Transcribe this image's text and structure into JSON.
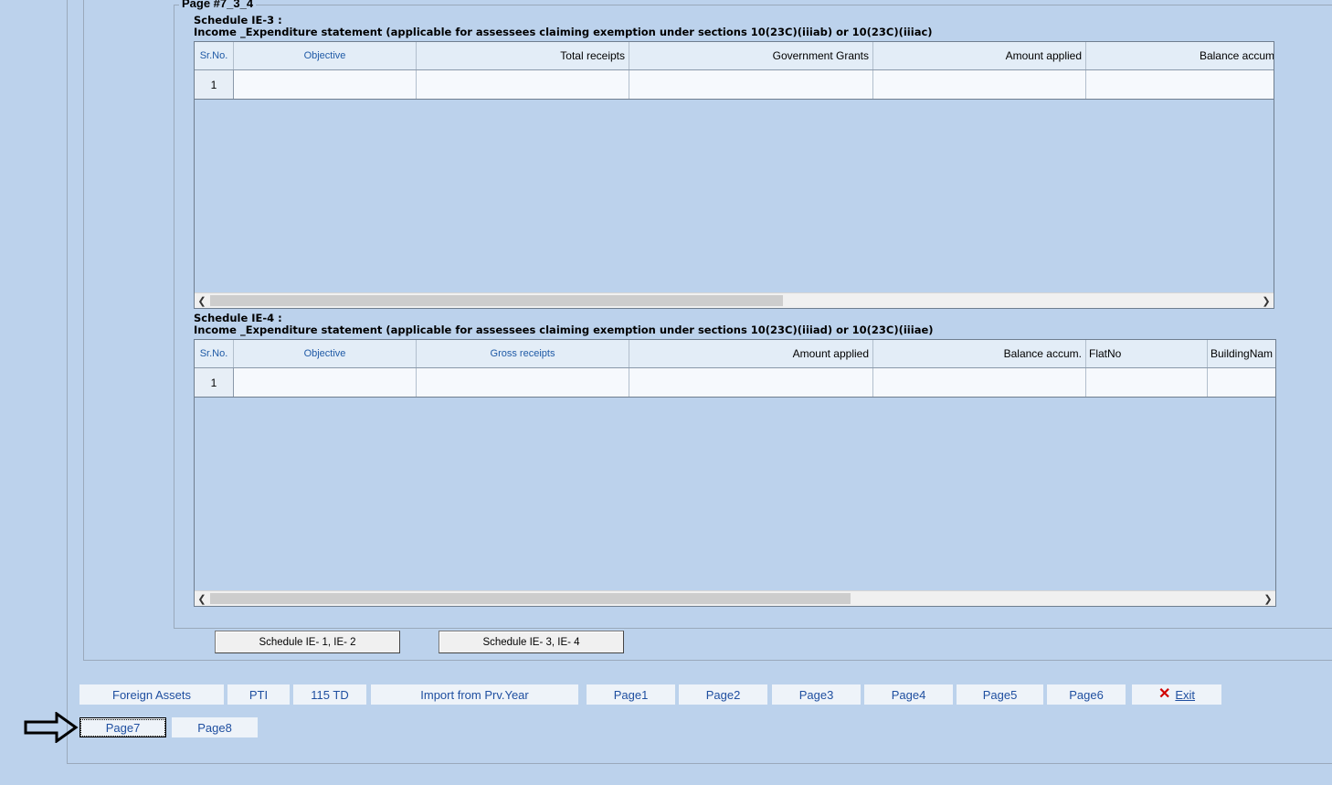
{
  "page": {
    "legend": "Page #7_3_4"
  },
  "ie3": {
    "title_line1": "Schedule IE-3 :",
    "title_line2": "Income _Expenditure statement (applicable for assessees claiming exemption under sections 10(23C)(iiiab) or 10(23C)(iiiac)",
    "columns": [
      "Sr.No.",
      "Objective",
      "Total receipts",
      "Government Grants",
      "Amount applied",
      "Balance accum"
    ],
    "rows": [
      {
        "sr": "1",
        "cells": [
          "",
          "",
          "",
          "",
          ""
        ]
      }
    ]
  },
  "ie4": {
    "title_line1": "Schedule IE-4 :",
    "title_line2": "Income _Expenditure statement (applicable for assessees claiming exemption under sections 10(23C)(iiiad) or 10(23C)(iiiae)",
    "columns": [
      "Sr.No.",
      "Objective",
      "Gross receipts",
      "Amount applied",
      "Balance accum.",
      "FlatNo",
      "BuildingNam"
    ],
    "rows": [
      {
        "sr": "1",
        "cells": [
          "",
          "",
          "",
          "",
          "",
          ""
        ]
      }
    ]
  },
  "tabs": {
    "ie12": "Schedule IE- 1, IE- 2",
    "ie34": "Schedule IE- 3, IE- 4"
  },
  "nav": {
    "foreign_assets": "Foreign Assets",
    "pti": "PTI",
    "td115": "115 TD",
    "import_prev": "Import from Prv.Year",
    "page1": "Page1",
    "page2": "Page2",
    "page3": "Page3",
    "page4": "Page4",
    "page5": "Page5",
    "page6": "Page6",
    "exit": "Exit",
    "page7": "Page7",
    "page8": "Page8"
  },
  "colors": {
    "background": "#bcd2ec",
    "header_blue_text": "#1f5aa6",
    "exit_icon": "#d10000"
  },
  "icons": {
    "exit": "close-x-icon",
    "pointer": "right-arrow-icon"
  }
}
